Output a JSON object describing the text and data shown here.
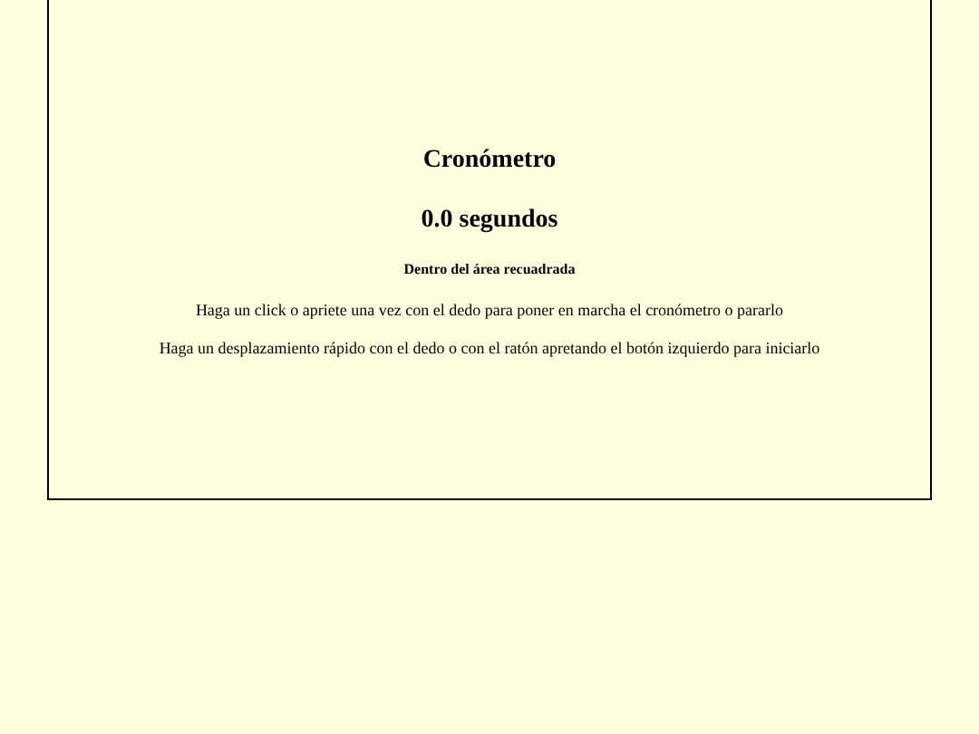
{
  "title": "Cronómetro",
  "time": "0.0 segundos",
  "subtitle": "Dentro del área recuadrada",
  "instructions": [
    "Haga un click o apriete una vez con el dedo para poner en marcha el cronómetro o pararlo",
    "Haga un desplazamiento rápido con el dedo o con el ratón apretando el botón izquierdo para iniciarlo"
  ]
}
